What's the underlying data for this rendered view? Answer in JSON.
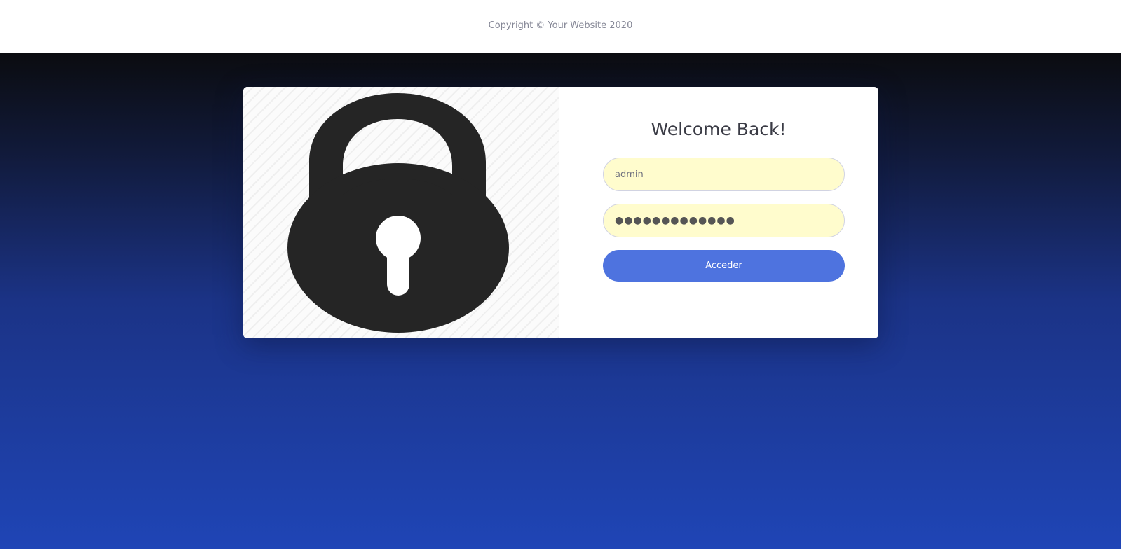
{
  "footer": {
    "copyright": "Copyright © Your Website 2020"
  },
  "login": {
    "title": "Welcome Back!",
    "username_value": "admin",
    "password_value": "●●●●●●●●●●●●●",
    "submit_label": "Acceder"
  },
  "icons": {
    "hero": "padlock-icon"
  },
  "colors": {
    "button": "#4e73df",
    "input_bg": "#fffccd",
    "gradient_top": "#0b0c10",
    "gradient_bottom": "#1f45b6",
    "lock": "#252525"
  }
}
